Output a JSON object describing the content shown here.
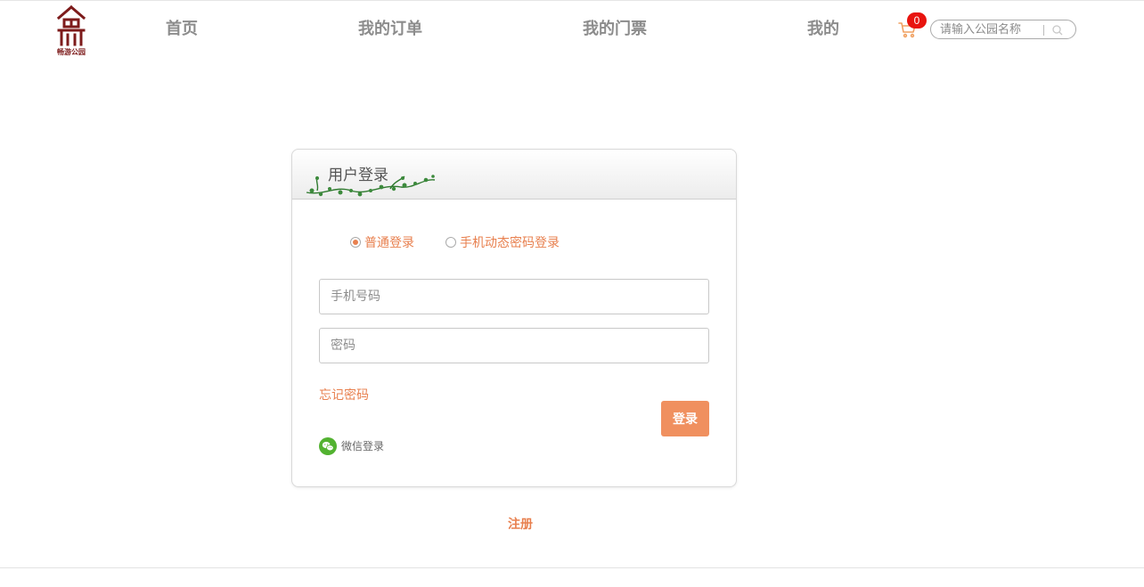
{
  "brand": {
    "logo_text": "畅游公园"
  },
  "nav": {
    "home": "首页",
    "orders": "我的订单",
    "tickets": "我的门票",
    "mine": "我的"
  },
  "cart": {
    "count": "0",
    "icon": "cart-icon"
  },
  "search": {
    "placeholder": "请输入公园名称",
    "icon": "search-icon"
  },
  "login": {
    "title": "用户登录",
    "modes": [
      {
        "label": "普通登录",
        "selected": true
      },
      {
        "label": "手机动态密码登录",
        "selected": false
      }
    ],
    "phone_placeholder": "手机号码",
    "password_placeholder": "密码",
    "forgot": "忘记密码",
    "submit": "登录",
    "wechat": "微信登录"
  },
  "register": "注册",
  "colors": {
    "accent": "#e8804f",
    "button": "#f0905f",
    "badge": "#e8140f",
    "logo": "#7d1b1b",
    "nav": "#8c8c8c",
    "wechat": "#52b230"
  }
}
